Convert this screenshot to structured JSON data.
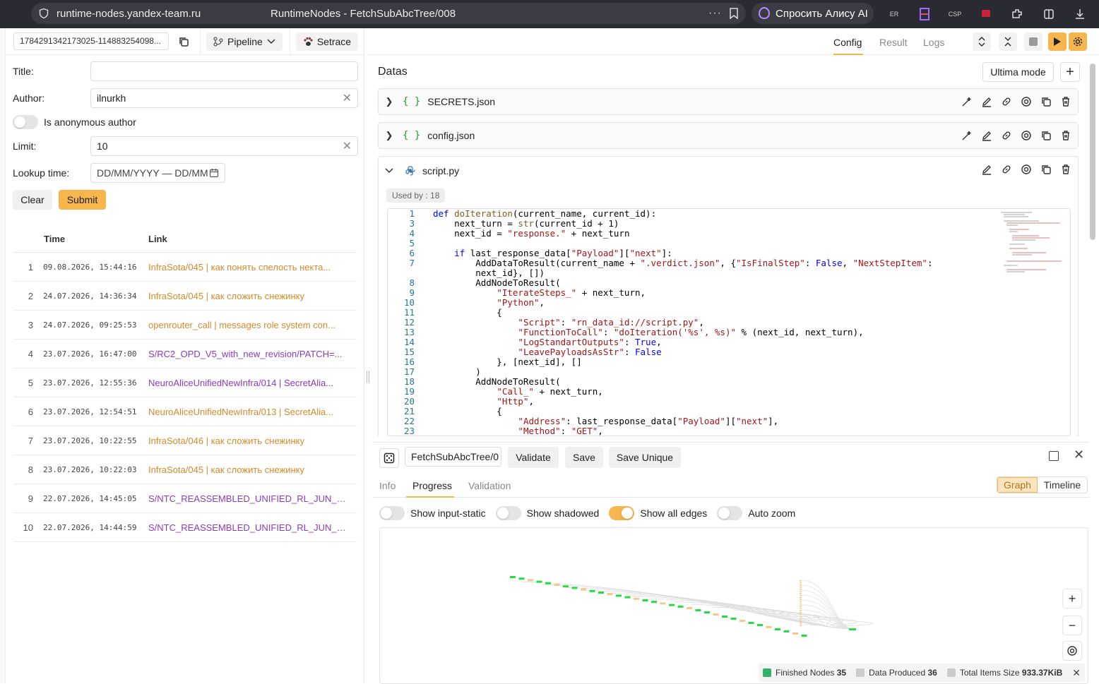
{
  "browser": {
    "host": "runtime-nodes.yandex-team.ru",
    "title": "RuntimeNodes - FetchSubAbcTree/008",
    "dots": "···",
    "alice_label": "Спросить Алису AI",
    "ext_labels": [
      "ER",
      "CSP"
    ]
  },
  "toolbar": {
    "run_id": "1784291342173025-114883254098...",
    "pipeline_label": "Pipeline",
    "setrace_label": "Setrace"
  },
  "right_tabs": [
    "Config",
    "Result",
    "Logs"
  ],
  "form": {
    "title_label": "Title:",
    "title_value": "",
    "author_label": "Author:",
    "author_value": "ilnurkh",
    "anonymous_label": "Is anonymous author",
    "limit_label": "Limit:",
    "limit_value": "10",
    "lookup_label": "Lookup time:",
    "lookup_placeholder": "DD/MM/YYYY — DD/MM",
    "clear_label": "Clear",
    "submit_label": "Submit"
  },
  "history": {
    "col_time": "Time",
    "col_link": "Link",
    "rows": [
      {
        "n": "1",
        "time": "09.08.2026, 15:44:16",
        "link": "InfraSota/045 | как понять спелость некта...",
        "color": "orange"
      },
      {
        "n": "2",
        "time": "24.07.2026, 14:36:34",
        "link": "InfraSota/045 | как сложить снежинку",
        "color": "orange"
      },
      {
        "n": "3",
        "time": "24.07.2026, 09:25:53",
        "link": "openrouter_call | messages role system con...",
        "color": "orange"
      },
      {
        "n": "4",
        "time": "23.07.2026, 16:47:00",
        "link": "S/RC2_OPD_V5_with_new_revision/PATCH=...",
        "color": "purple"
      },
      {
        "n": "5",
        "time": "23.07.2026, 12:55:36",
        "link": "NeuroAliceUnifiedNewInfra/014 | SecretAlia...",
        "color": "purple"
      },
      {
        "n": "6",
        "time": "23.07.2026, 12:54:51",
        "link": "NeuroAliceUnifiedNewInfra/013 | SecretAlia...",
        "color": "orange"
      },
      {
        "n": "7",
        "time": "23.07.2026, 10:22:55",
        "link": "InfraSota/046 | как сложить снежинку",
        "color": "orange"
      },
      {
        "n": "8",
        "time": "23.07.2026, 10:22:03",
        "link": "InfraSota/045 | как сложить снежинку",
        "color": "orange"
      },
      {
        "n": "9",
        "time": "22.07.2026, 14:45:05",
        "link": "S/NTC_REASSEMBLED_UNIFIED_RL_JUN_0...",
        "color": "purple"
      },
      {
        "n": "10",
        "time": "22.07.2026, 14:44:59",
        "link": "S/NTC_REASSEMBLED_UNIFIED_RL_JUN_0...",
        "color": "purple"
      }
    ]
  },
  "datas": {
    "title": "Datas",
    "ultima_label": "Ultima mode",
    "plus_label": "+",
    "files": [
      {
        "name": "SECRETS.json",
        "icon": "braces-icon"
      },
      {
        "name": "config.json",
        "icon": "braces-icon"
      },
      {
        "name": "script.py",
        "icon": "python-icon"
      }
    ],
    "used_by": "Used by : 18"
  },
  "code": [
    {
      "n": "1",
      "html": "<span class='kw'>def</span> <span class='fn'>doIteration</span>(current_name, current_id):"
    },
    {
      "n": "3",
      "html": "    next_turn = <span class='fn'>str</span>(current_id + 1)"
    },
    {
      "n": "4",
      "html": "    next_id = <span class='st'>\"response.\"</span> + next_turn"
    },
    {
      "n": "5",
      "html": ""
    },
    {
      "n": "6",
      "html": "    <span class='kw'>if</span> last_response_data[<span class='st'>\"Payload\"</span>][<span class='st'>\"next\"</span>]:"
    },
    {
      "n": "7",
      "html": "        AddDataToResult(current_name + <span class='st'>\".verdict.json\"</span>, {<span class='st'>\"IsFinalStep\"</span>: <span class='kw'>False</span>, <span class='st'>\"NextStepItem\"</span>:"
    },
    {
      "n": "",
      "html": "        next_id}, [])"
    },
    {
      "n": "8",
      "html": "        AddNodeToResult("
    },
    {
      "n": "9",
      "html": "            <span class='st'>\"IterateSteps_\"</span> + next_turn,"
    },
    {
      "n": "10",
      "html": "            <span class='st'>\"Python\"</span>,"
    },
    {
      "n": "11",
      "html": "            {"
    },
    {
      "n": "12",
      "html": "                <span class='st'>\"Script\"</span>: <span class='st'>\"rn_data_id://script.py\"</span>,"
    },
    {
      "n": "13",
      "html": "                <span class='st'>\"FunctionToCall\"</span>: <span class='st'>\"doIteration('%s', %s)\"</span> % (next_id, next_turn),"
    },
    {
      "n": "14",
      "html": "                <span class='st'>\"LogStandartOutputs\"</span>: <span class='kw'>True</span>,"
    },
    {
      "n": "15",
      "html": "                <span class='st'>\"LeavePayloadsAsStr\"</span>: <span class='kw'>False</span>"
    },
    {
      "n": "16",
      "html": "            }, [next_id], []"
    },
    {
      "n": "17",
      "html": "        )"
    },
    {
      "n": "18",
      "html": "        AddNodeToResult("
    },
    {
      "n": "19",
      "html": "            <span class='st'>\"Call_\"</span> + next_turn,"
    },
    {
      "n": "20",
      "html": "            <span class='st'>\"Http\"</span>,"
    },
    {
      "n": "21",
      "html": "            {"
    },
    {
      "n": "22",
      "html": "                <span class='st'>\"Address\"</span>: last_response_data[<span class='st'>\"Payload\"</span>][<span class='st'>\"next\"</span>],"
    },
    {
      "n": "23",
      "html": "                <span class='st'>\"Method\"</span>: <span class='st'>\"GET\"</span>,"
    }
  ],
  "bottom": {
    "node_name": "FetchSubAbcTree/0",
    "validate_label": "Validate",
    "save_label": "Save",
    "save_unique_label": "Save Unique",
    "tabs": [
      "Info",
      "Progress",
      "Validation"
    ],
    "graph_label": "Graph",
    "timeline_label": "Timeline",
    "toggles": [
      {
        "label": "Show input-static",
        "on": false
      },
      {
        "label": "Show shadowed",
        "on": false
      },
      {
        "label": "Show all edges",
        "on": true
      },
      {
        "label": "Auto zoom",
        "on": false
      }
    ],
    "zoom_in": "+",
    "zoom_out": "−",
    "legend": {
      "finished_label": "Finished Nodes",
      "finished_value": "35",
      "data_label": "Data Produced",
      "data_value": "36",
      "size_label": "Total Items Size",
      "size_value": "933.37KiB",
      "colors": {
        "finished": "#2fb36b",
        "data": "#cccccc",
        "size": "#cccccc"
      }
    }
  },
  "colors": {
    "accent": "#f7b54d",
    "link_orange": "#d48a2a",
    "link_purple": "#8a3bbf",
    "node_green": "#22dd44"
  }
}
